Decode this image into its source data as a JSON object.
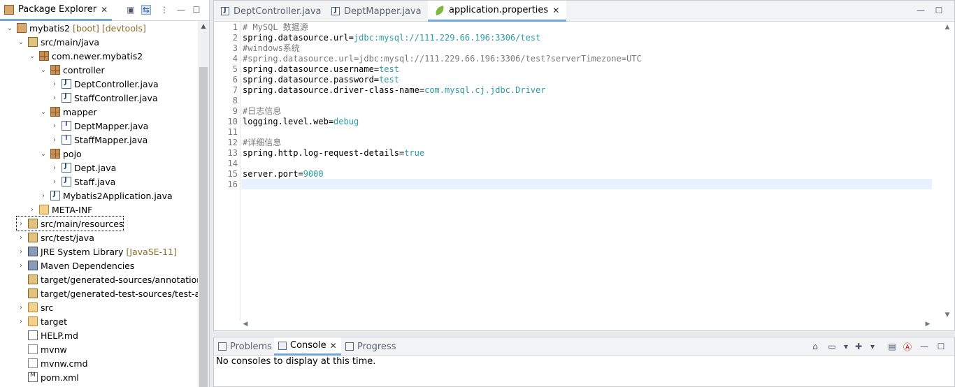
{
  "package_explorer": {
    "title": "Package Explorer",
    "tree": [
      {
        "label": "mybatis2",
        "decoration": "[boot] [devtools]",
        "icon": "project-icon",
        "expanded": true
      },
      {
        "label": "src/main/java",
        "icon": "source-folder-icon",
        "expanded": true
      },
      {
        "label": "com.newer.mybatis2",
        "icon": "package-icon",
        "expanded": true
      },
      {
        "label": "controller",
        "icon": "package-icon",
        "expanded": true
      },
      {
        "label": "DeptController.java",
        "icon": "java-file-icon"
      },
      {
        "label": "StaffController.java",
        "icon": "java-file-icon"
      },
      {
        "label": "mapper",
        "icon": "package-icon",
        "expanded": true
      },
      {
        "label": "DeptMapper.java",
        "icon": "java-interface-icon"
      },
      {
        "label": "StaffMapper.java",
        "icon": "java-interface-icon"
      },
      {
        "label": "pojo",
        "icon": "package-icon",
        "expanded": true
      },
      {
        "label": "Dept.java",
        "icon": "java-file-icon"
      },
      {
        "label": "Staff.java",
        "icon": "java-file-icon"
      },
      {
        "label": "Mybatis2Application.java",
        "icon": "java-file-icon"
      },
      {
        "label": "META-INF",
        "icon": "folder-icon"
      },
      {
        "label": "src/main/resources",
        "icon": "source-folder-icon",
        "selected": true
      },
      {
        "label": "src/test/java",
        "icon": "source-folder-icon"
      },
      {
        "label": "JRE System Library",
        "decoration": "[JavaSE-11]",
        "icon": "library-icon"
      },
      {
        "label": "Maven Dependencies",
        "icon": "library-icon"
      },
      {
        "label": "target/generated-sources/annotations",
        "icon": "source-folder-icon"
      },
      {
        "label": "target/generated-test-sources/test-an",
        "icon": "source-folder-icon"
      },
      {
        "label": "src",
        "icon": "folder-icon"
      },
      {
        "label": "target",
        "icon": "folder-icon"
      },
      {
        "label": "HELP.md",
        "icon": "markdown-file-icon"
      },
      {
        "label": "mvnw",
        "icon": "file-icon"
      },
      {
        "label": "mvnw.cmd",
        "icon": "file-icon"
      },
      {
        "label": "pom.xml",
        "icon": "maven-pom-icon"
      }
    ]
  },
  "editor": {
    "tabs": [
      {
        "label": "DeptController.java",
        "active": false
      },
      {
        "label": "DeptMapper.java",
        "active": false
      },
      {
        "label": "application.properties",
        "active": true
      }
    ],
    "lines": [
      {
        "n": "1",
        "parts": [
          {
            "t": "# MySQL 数据源",
            "c": "c"
          }
        ]
      },
      {
        "n": "2",
        "parts": [
          {
            "t": "spring.datasource.url=",
            "c": "k"
          },
          {
            "t": "jdbc:mysql://111.229.66.196:3306/test",
            "c": "v"
          }
        ]
      },
      {
        "n": "3",
        "parts": [
          {
            "t": "#windows系统",
            "c": "c"
          }
        ]
      },
      {
        "n": "4",
        "parts": [
          {
            "t": "#spring.datasource.url=jdbc:mysql://111.229.66.196:3306/test?serverTimezone=UTC",
            "c": "c"
          }
        ]
      },
      {
        "n": "5",
        "parts": [
          {
            "t": "spring.datasource.username=",
            "c": "k"
          },
          {
            "t": "test",
            "c": "v"
          }
        ]
      },
      {
        "n": "6",
        "parts": [
          {
            "t": "spring.datasource.password=",
            "c": "k"
          },
          {
            "t": "test",
            "c": "v"
          }
        ]
      },
      {
        "n": "7",
        "parts": [
          {
            "t": "spring.datasource.driver-class-name=",
            "c": "k"
          },
          {
            "t": "com.mysql.cj.jdbc.Driver",
            "c": "v"
          }
        ]
      },
      {
        "n": "8",
        "parts": []
      },
      {
        "n": "9",
        "parts": [
          {
            "t": "#日志信息",
            "c": "c"
          }
        ]
      },
      {
        "n": "10",
        "parts": [
          {
            "t": "logging.level.web=",
            "c": "k"
          },
          {
            "t": "debug",
            "c": "v"
          }
        ]
      },
      {
        "n": "11",
        "parts": []
      },
      {
        "n": "12",
        "parts": [
          {
            "t": "#详细信息",
            "c": "c"
          }
        ]
      },
      {
        "n": "13",
        "parts": [
          {
            "t": "spring.http.log-request-details=",
            "c": "k"
          },
          {
            "t": "true",
            "c": "v"
          }
        ]
      },
      {
        "n": "14",
        "parts": []
      },
      {
        "n": "15",
        "parts": [
          {
            "t": "server.port=",
            "c": "k"
          },
          {
            "t": "9000",
            "c": "v"
          }
        ]
      },
      {
        "n": "16",
        "parts": []
      }
    ],
    "current_line": "16"
  },
  "console": {
    "tabs": [
      {
        "label": "Problems",
        "active": false
      },
      {
        "label": "Console",
        "active": true
      },
      {
        "label": "Progress",
        "active": false
      }
    ],
    "message": "No consoles to display at this time."
  },
  "colors": {
    "accent": "#6fa8dc",
    "value": "#2a9ba6",
    "comment": "#7a7a7a"
  }
}
